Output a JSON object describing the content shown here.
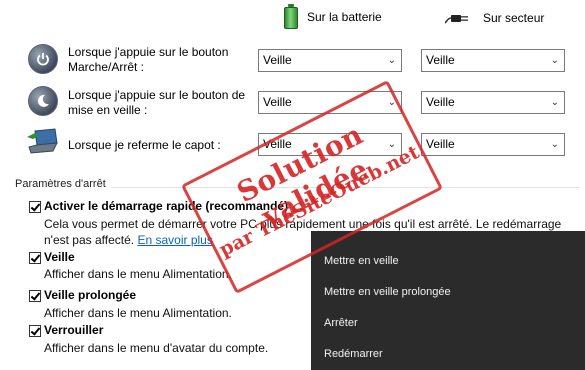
{
  "columns": {
    "battery_label": "Sur la batterie",
    "ac_label": "Sur secteur"
  },
  "rows": [
    {
      "label": "Lorsque j'appuie sur le bouton Marche/Arrêt :",
      "battery": "Veille",
      "ac": "Veille",
      "icon": "power-button-icon"
    },
    {
      "label": "Lorsque j'appuie sur le bouton de mise en veille :",
      "battery": "Veille",
      "ac": "Veille",
      "icon": "sleep-button-icon"
    },
    {
      "label": "Lorsque je referme le capot :",
      "battery": "Veille",
      "ac": "Veille",
      "icon": "laptop-lid-icon"
    }
  ],
  "shutdown_settings": {
    "title": "Paramètres d'arrêt",
    "options": [
      {
        "title": "Activer le démarrage rapide (recommandé)",
        "checked": true,
        "desc": "Cela vous permet de démarrer votre PC plus rapidement une fois qu'il est arrêté. Le redémarrage n'est pas affecté.",
        "link": "En savoir plus"
      },
      {
        "title": "Veille",
        "checked": true,
        "desc": "Afficher dans le menu Alimentation."
      },
      {
        "title": "Veille prolongée",
        "checked": true,
        "desc": "Afficher dans le menu Alimentation."
      },
      {
        "title": "Verrouiller",
        "checked": true,
        "desc": "Afficher dans le menu d'avatar du compte."
      }
    ]
  },
  "power_menu": {
    "items": [
      "Mettre en veille",
      "Mettre en veille prolongée",
      "Arrêter",
      "Redémarrer"
    ]
  },
  "stamp": {
    "line1": "Solution validée",
    "line2": "par TheSiteOueb.net",
    "color": "#d62222"
  }
}
